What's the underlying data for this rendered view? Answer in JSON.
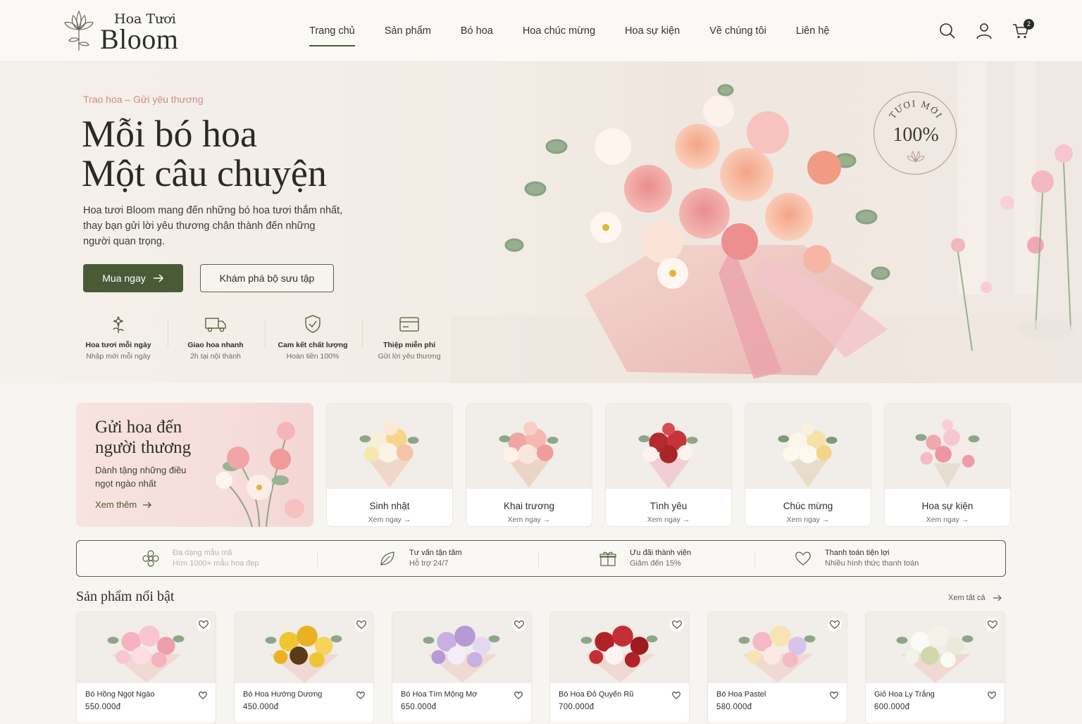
{
  "brand": {
    "small": "Hoa Tươi",
    "big": "Bloom"
  },
  "nav": {
    "items": [
      "Trang chủ",
      "Sản phẩm",
      "Bó hoa",
      "Hoa chúc mừng",
      "Hoa sự kiện",
      "Về chúng tôi",
      "Liên hệ"
    ],
    "active_index": 0
  },
  "header_icons": [
    "search-icon",
    "user-icon",
    "cart-icon"
  ],
  "cart": {
    "count": "2"
  },
  "hero": {
    "tag": "Trao hoa – Gửi yêu thương",
    "title_line1": "Mỗi bó hoa",
    "title_line2": "Một câu chuyện",
    "description": "Hoa tươi Bloom mang đến những bó hoa tươi thắm nhất, thay bạn gửi lời yêu thương chân thành đến những người quan trọng.",
    "primary_button": "Mua ngay",
    "secondary_button": "Khám phá bộ sưu tập",
    "badge_top": "TƯƠI MỚI",
    "badge_value": "100%",
    "features": [
      {
        "title": "Hoa tươi mỗi ngày",
        "sub": "Nhập mới mỗi ngày",
        "icon": "flower-icon"
      },
      {
        "title": "Giao hoa nhanh",
        "sub": "2h tại nội thành",
        "icon": "truck-icon"
      },
      {
        "title": "Cam kết chất lượng",
        "sub": "Hoàn tiền 100%",
        "icon": "shield-check-icon"
      },
      {
        "title": "Thiệp miễn phí",
        "sub": "Gửi lời yêu thương",
        "icon": "card-icon"
      }
    ]
  },
  "promo": {
    "title": "Gửi hoa đến người thương",
    "sub": "Dành tặng những điều ngọt ngào nhất",
    "link": "Xem thêm"
  },
  "categories": [
    {
      "name": "Sinh nhật",
      "link": "Xem ngay"
    },
    {
      "name": "Khai trương",
      "link": "Xem ngay"
    },
    {
      "name": "Tình yêu",
      "link": "Xem ngay"
    },
    {
      "name": "Chúc mừng",
      "link": "Xem ngay"
    },
    {
      "name": "Hoa sự kiện",
      "link": "Xem ngay"
    }
  ],
  "benefits": [
    {
      "title": "Đa dạng mẫu mã",
      "sub": "Hơn 1000+ mẫu hoa đẹp",
      "icon": "flower-outline-icon"
    },
    {
      "title": "Tư vấn tận tâm",
      "sub": "Hỗ trợ 24/7",
      "icon": "leaf-icon"
    },
    {
      "title": "Ưu đãi thành viên",
      "sub": "Giảm đến 15%",
      "icon": "gift-icon"
    },
    {
      "title": "Thanh toán tiện lợi",
      "sub": "Nhiều hình thức thanh toán",
      "icon": "heart-icon"
    }
  ],
  "featured": {
    "title": "Sản phẩm nổi bật",
    "see_all": "Xem tất cả",
    "products": [
      {
        "name": "Bó Hồng Ngọt Ngào",
        "price": "550.000đ"
      },
      {
        "name": "Bó Hoa Hướng Dương",
        "price": "450.000đ"
      },
      {
        "name": "Bó Hoa Tím Mộng Mơ",
        "price": "650.000đ"
      },
      {
        "name": "Bó Hoa Đỏ Quyến Rũ",
        "price": "700.000đ"
      },
      {
        "name": "Bó Hoa Pastel",
        "price": "580.000đ"
      },
      {
        "name": "Giỏ Hoa Ly Trắng",
        "price": "600.000đ"
      }
    ]
  },
  "colors": {
    "primary": "#4b5a36",
    "accent_pink": "#d38a86",
    "background": "#f7f5f1"
  }
}
